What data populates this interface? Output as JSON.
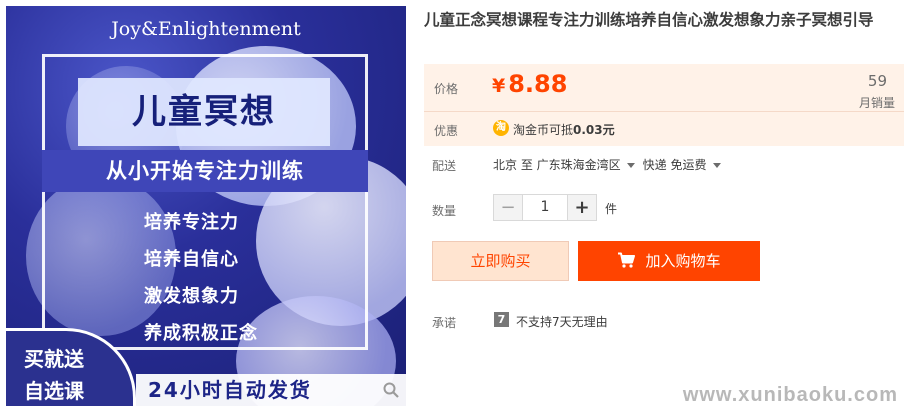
{
  "product_image": {
    "brand": "Joy&Enlightenment",
    "title": "儿童冥想",
    "subtitle": "从小开始专注力训练",
    "benefits": [
      "培养专注力",
      "培养自信心",
      "激发想象力",
      "养成积极正念"
    ],
    "promo_line1": "买就送",
    "promo_line2": "自选课",
    "delivery": "24小时自动发货"
  },
  "product": {
    "title": "儿童正念冥想课程专注力训练培养自信心激发想象力亲子冥想引导"
  },
  "price": {
    "label": "价格",
    "currency": "¥",
    "value": "8.88",
    "sales_count": "59",
    "sales_label": "月销量"
  },
  "discount": {
    "label": "优惠",
    "coin_glyph": "淘",
    "text": "淘金币可抵",
    "amount": "0.03元"
  },
  "shipping": {
    "label": "配送",
    "origin": "北京 至",
    "destination": "广东珠海金湾区",
    "method": "快递 免运费"
  },
  "quantity": {
    "label": "数量",
    "minus": "−",
    "value": "1",
    "plus": "+",
    "unit": "件"
  },
  "actions": {
    "buy_now": "立即购买",
    "add_to_cart": "加入购物车"
  },
  "promise": {
    "label": "承诺",
    "icon_glyph": "7",
    "text": "不支持7天无理由"
  },
  "watermark": "www.xunibaoku.com",
  "colors": {
    "accent": "#ff4400",
    "price_bg": "#fff2e8",
    "buy_now_bg": "#ffe4d0",
    "image_blue": "#2a2f9a"
  }
}
